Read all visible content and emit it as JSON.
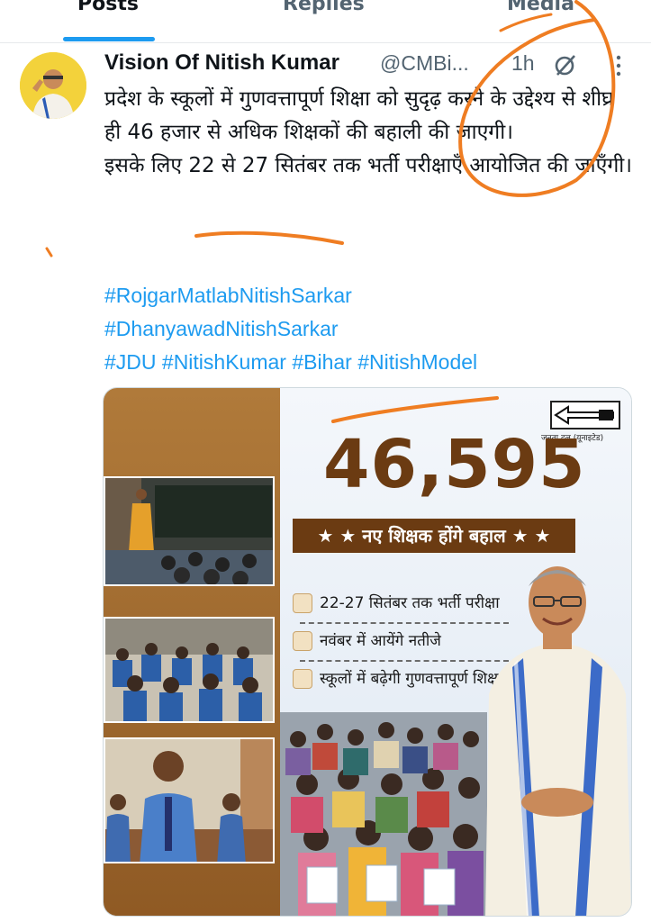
{
  "tabs": [
    {
      "label": "Posts",
      "active": true
    },
    {
      "label": "Replies",
      "active": false
    },
    {
      "label": "Media",
      "active": false
    }
  ],
  "tweet": {
    "name": "Vision Of Nitish Kumar",
    "handle": "@CMBi...",
    "dot": "·",
    "time": "1h",
    "text_lines": [
      "प्रदेश के स्कूलों में गुणवत्तापूर्ण शिक्षा को सुदृढ़ करने के उद्देश्य से शीघ्र ही 46 हजार से अधिक शिक्षकों की बहाली की जाएगी।",
      "इसके लिए 22 से 27 सितंबर तक भर्ती परीक्षाएँ आयोजित की जाएँगी।"
    ],
    "hashtags": [
      "#RojgarMatlabNitishSarkar",
      "#DhanyawadNitishSarkar",
      "#JDU #NitishKumar #Bihar #NitishModel"
    ]
  },
  "media": {
    "big_number": "46,595",
    "banner": "★ ★ नए शिक्षक होंगे बहाल ★ ★",
    "party_name": "जनता दल (यूनाइटेड)",
    "points": [
      "22-27 सितंबर तक भर्ती परीक्षा",
      "नवंबर में आयेंगे नतीजे",
      "स्कूलों में बढ़ेगी गुणवत्तापूर्ण शिक्षा"
    ]
  },
  "colors": {
    "accent": "#1d9bf0",
    "brown": "#6b3b12",
    "annotation": "#ef7d22"
  },
  "icons": {
    "grok": "grok-icon",
    "more": "more-icon",
    "party_logo": "arrow-logo"
  }
}
